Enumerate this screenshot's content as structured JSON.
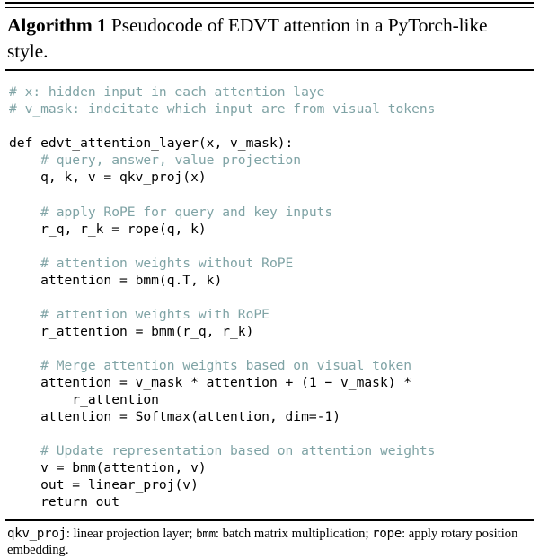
{
  "caption": {
    "label": "Algorithm 1",
    "text": "Pseudocode of EDVT attention in a PyTorch-like style."
  },
  "code": {
    "lines": [
      {
        "kind": "comment",
        "text": "# x: hidden input in each attention laye"
      },
      {
        "kind": "comment",
        "text": "# v_mask: indcitate which input are from visual tokens"
      },
      {
        "kind": "blank",
        "text": ""
      },
      {
        "kind": "code",
        "text": "def edvt_attention_layer(x, v_mask):"
      },
      {
        "kind": "comment",
        "text": "    # query, answer, value projection"
      },
      {
        "kind": "code",
        "text": "    q, k, v = qkv_proj(x)"
      },
      {
        "kind": "blank",
        "text": ""
      },
      {
        "kind": "comment",
        "text": "    # apply RoPE for query and key inputs"
      },
      {
        "kind": "code",
        "text": "    r_q, r_k = rope(q, k)"
      },
      {
        "kind": "blank",
        "text": ""
      },
      {
        "kind": "comment",
        "text": "    # attention weights without RoPE"
      },
      {
        "kind": "code",
        "text": "    attention = bmm(q.T, k)"
      },
      {
        "kind": "blank",
        "text": ""
      },
      {
        "kind": "comment",
        "text": "    # attention weights with RoPE"
      },
      {
        "kind": "code",
        "text": "    r_attention = bmm(r_q, r_k)"
      },
      {
        "kind": "blank",
        "text": ""
      },
      {
        "kind": "comment",
        "text": "    # Merge attention weights based on visual token"
      },
      {
        "kind": "code",
        "text": "    attention = v_mask * attention + (1 − v_mask) *"
      },
      {
        "kind": "code",
        "text": "        r_attention"
      },
      {
        "kind": "code",
        "text": "    attention = Softmax(attention, dim=-1)"
      },
      {
        "kind": "blank",
        "text": ""
      },
      {
        "kind": "comment",
        "text": "    # Update representation based on attention weights"
      },
      {
        "kind": "code",
        "text": "    v = bmm(attention, v)"
      },
      {
        "kind": "code",
        "text": "    out = linear_proj(v)"
      },
      {
        "kind": "code",
        "text": "    return out"
      }
    ],
    "comment_color": "#7fa3a5",
    "text_color": "#000000"
  },
  "footnote": {
    "term1": "qkv_proj",
    "desc1": ": linear projection layer; ",
    "term2": "bmm",
    "desc2": ": batch matrix multiplication; ",
    "term3": "rope",
    "desc3": ": apply rotary position embedding."
  }
}
